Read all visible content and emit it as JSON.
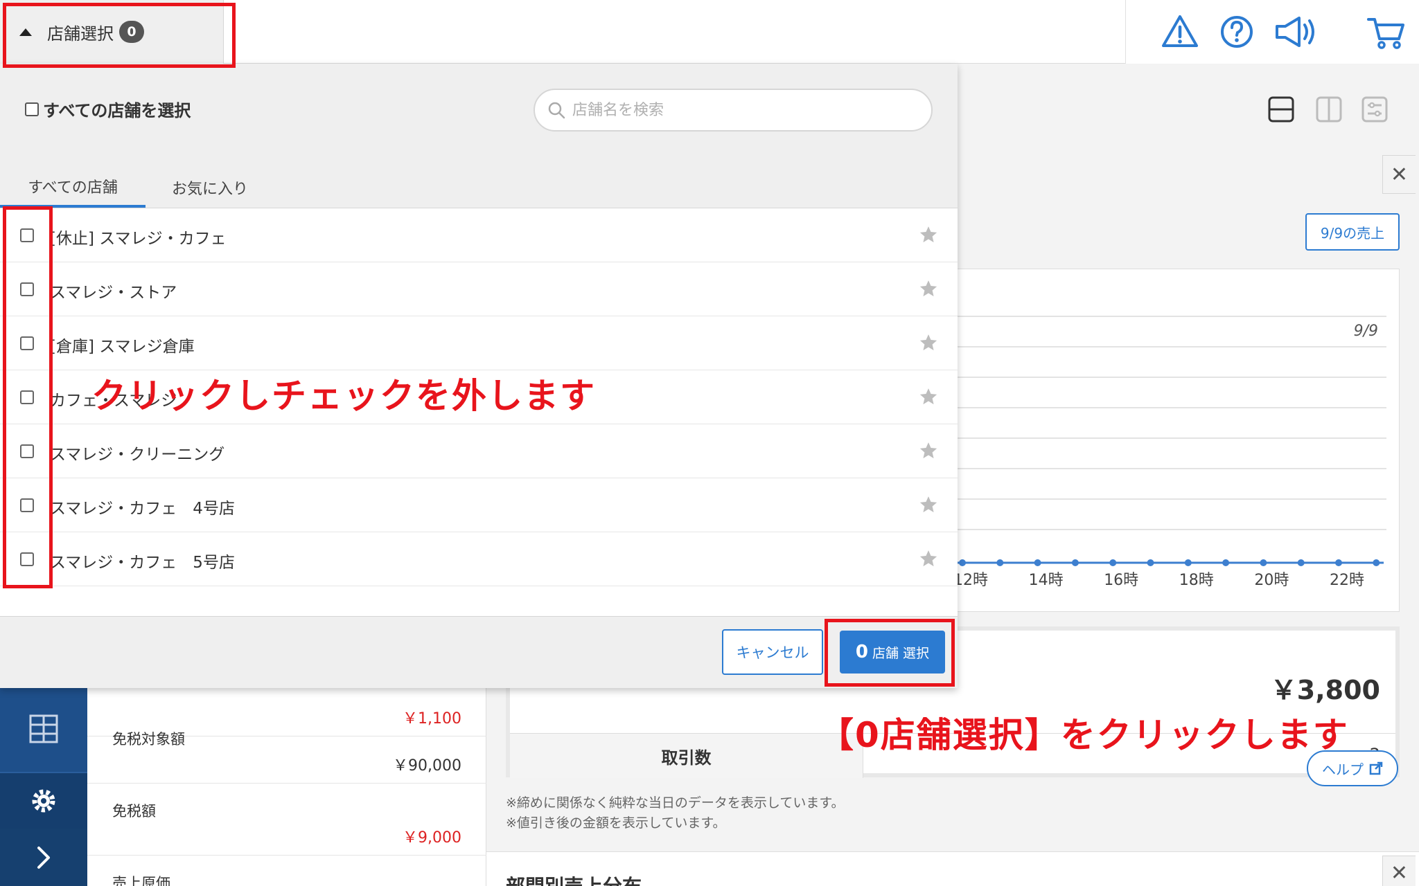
{
  "header": {
    "store_select_label": "店舗選択",
    "store_count": "0",
    "icons": [
      "warning-icon",
      "help-icon",
      "megaphone-icon",
      "cart-icon"
    ]
  },
  "modal": {
    "select_all_label": "すべての店舗を選択",
    "search_placeholder": "店舗名を検索",
    "tabs": [
      {
        "label": "すべての店舗",
        "active": true
      },
      {
        "label": "お気に入り",
        "active": false
      }
    ],
    "stores": [
      {
        "name": "[休止] スマレジ・カフェ"
      },
      {
        "name": "スマレジ・ストア"
      },
      {
        "name": "[倉庫] スマレジ倉庫"
      },
      {
        "name": "カフェ・スマレジ"
      },
      {
        "name": "スマレジ・クリーニング"
      },
      {
        "name": "スマレジ・カフェ　4号店"
      },
      {
        "name": "スマレジ・カフェ　5号店"
      }
    ],
    "cancel_label": "キャンセル",
    "confirm_count": "0",
    "confirm_label": "店舗 選択"
  },
  "dashboard": {
    "sales_button": "9/9の売上",
    "chart_date": "9/9",
    "time_ticks": [
      "12時",
      "14時",
      "16時",
      "18時",
      "20時",
      "22時"
    ],
    "total_amount": "￥3,800",
    "transactions_label": "取引数",
    "transactions_value": "2",
    "notes": [
      "※締めに関係なく純粋な当日のデータを表示しています。",
      "※値引き後の金額を表示しています。"
    ],
    "dept_title": "部門別売上分布",
    "help_label": "ヘルプ",
    "left_items": [
      {
        "label": "",
        "value": "￥1,100",
        "red": true
      },
      {
        "label": "免税対象額",
        "value": "￥90,000",
        "red": false
      },
      {
        "label": "免税額",
        "value": "￥9,000",
        "red": true
      },
      {
        "label": "売上原価",
        "value": "",
        "red": false
      }
    ]
  },
  "annotations": {
    "uncheck_text": "クリックしチェックを外します",
    "click_text": "【0店舗選択】をクリックします",
    "color": "#e8141c"
  },
  "colors": {
    "accent": "#2c7bd1",
    "sidebar": "#1e4f8a",
    "annotation": "#e8141c"
  }
}
